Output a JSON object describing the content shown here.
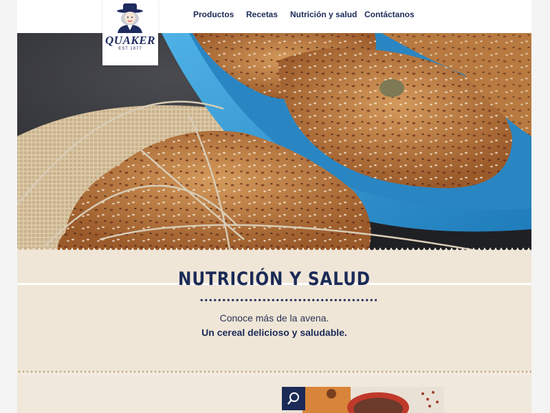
{
  "brand": {
    "logo_name": "QUAKER",
    "logo_tagline": "EST 1877",
    "logo_icon": "quaker-man-icon"
  },
  "nav": {
    "items": [
      {
        "label": "Productos"
      },
      {
        "label": "Recetas"
      },
      {
        "label": "Nutrición y salud"
      },
      {
        "label": "Contáctanos"
      }
    ]
  },
  "hero": {
    "image": "oat-crisps-photo"
  },
  "section": {
    "title": "NUTRICIÓN Y SALUD",
    "intro_line": "Conoce más de la avena.",
    "intro_bold": "Un cereal delicioso y saludable."
  },
  "gallery": {
    "zoom_icon": "search-icon"
  },
  "colors": {
    "brand_navy": "#1b2a57",
    "section_bg": "#efe6d7",
    "plate_blue": "#2f8fc8"
  }
}
